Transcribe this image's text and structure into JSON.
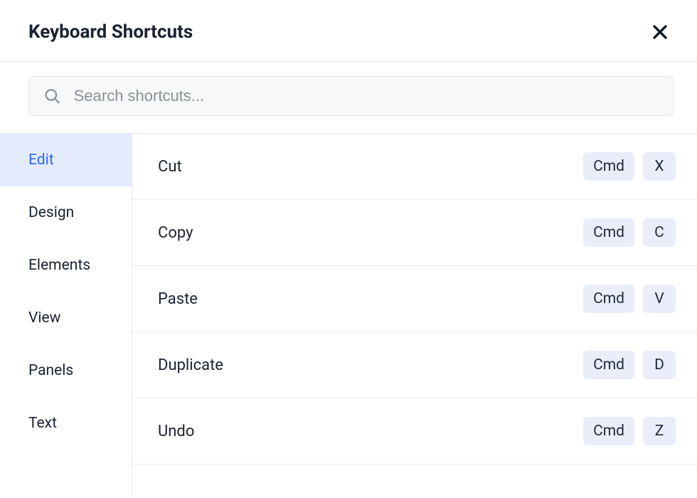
{
  "title": "Keyboard Shortcuts",
  "search": {
    "placeholder": "Search shortcuts..."
  },
  "sidebar": {
    "items": [
      {
        "label": "Edit",
        "active": true
      },
      {
        "label": "Design",
        "active": false
      },
      {
        "label": "Elements",
        "active": false
      },
      {
        "label": "View",
        "active": false
      },
      {
        "label": "Panels",
        "active": false
      },
      {
        "label": "Text",
        "active": false
      }
    ]
  },
  "shortcuts": [
    {
      "label": "Cut",
      "keys": [
        "Cmd",
        "X"
      ]
    },
    {
      "label": "Copy",
      "keys": [
        "Cmd",
        "C"
      ]
    },
    {
      "label": "Paste",
      "keys": [
        "Cmd",
        "V"
      ]
    },
    {
      "label": "Duplicate",
      "keys": [
        "Cmd",
        "D"
      ]
    },
    {
      "label": "Undo",
      "keys": [
        "Cmd",
        "Z"
      ]
    }
  ]
}
